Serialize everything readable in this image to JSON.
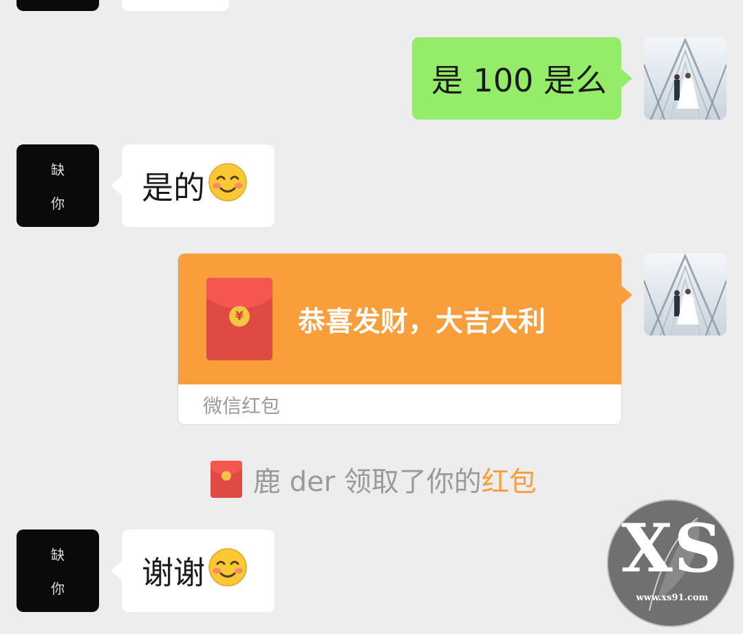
{
  "contact": {
    "avatar_glyphs": [
      "缺",
      "你"
    ]
  },
  "messages": [
    {
      "from": "me",
      "text": "是 100 是么"
    },
    {
      "from": "contact",
      "text": "是的",
      "emoji": "smiling-face-with-blush"
    },
    {
      "from": "me",
      "type": "red_packet",
      "title": "恭喜发财，大吉大利",
      "brand": "微信红包",
      "coin_symbol": "¥"
    },
    {
      "from": "contact",
      "text": "谢谢",
      "emoji": "smiling-face-with-blush"
    }
  ],
  "notice": {
    "prefix": "鹿 der 领取了你的",
    "link": "红包"
  },
  "watermark": {
    "letters": "XS",
    "url": "www.xs91.com"
  },
  "colors": {
    "background": "#ededed",
    "my_bubble": "#95ec69",
    "their_bubble": "#ffffff",
    "red_packet": "#f99e3b",
    "envelope": "#e04a45",
    "link": "#f99e3b"
  }
}
